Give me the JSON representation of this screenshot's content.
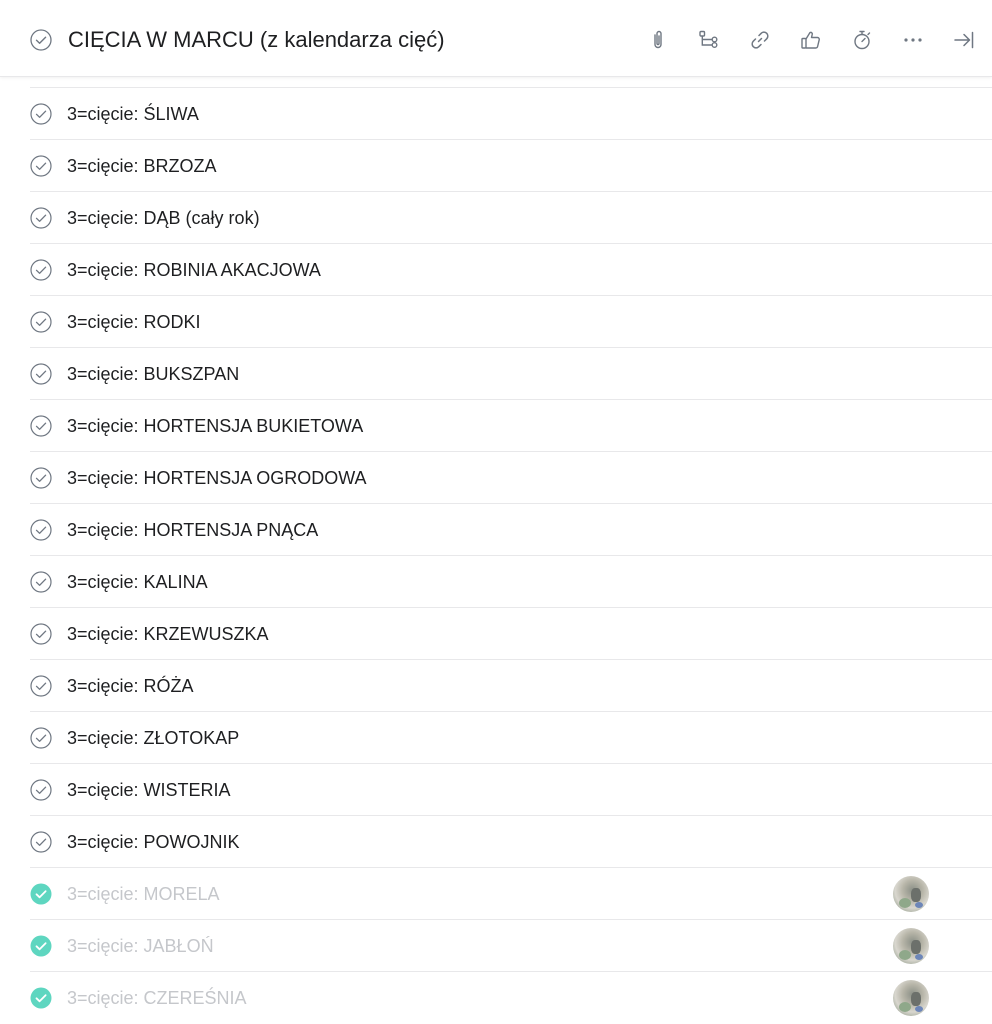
{
  "header": {
    "title": "CIĘCIA W MARCU (z kalendarza cięć)",
    "toolbar": [
      {
        "icon": "paperclip-icon"
      },
      {
        "icon": "subtask-icon"
      },
      {
        "icon": "link-icon"
      },
      {
        "icon": "thumbs-up-icon"
      },
      {
        "icon": "timer-icon"
      },
      {
        "icon": "more-icon"
      },
      {
        "icon": "close-pane-icon"
      }
    ]
  },
  "tasks": [
    {
      "label": "3=cięcie: ŚLIWA",
      "completed": false
    },
    {
      "label": "3=cięcie: BRZOZA",
      "completed": false
    },
    {
      "label": "3=cięcie: DĄB (cały rok)",
      "completed": false
    },
    {
      "label": "3=cięcie: ROBINIA AKACJOWA",
      "completed": false
    },
    {
      "label": "3=cięcie: RODKI",
      "completed": false
    },
    {
      "label": "3=cięcie: BUKSZPAN",
      "completed": false
    },
    {
      "label": "3=cięcie: HORTENSJA BUKIETOWA",
      "completed": false
    },
    {
      "label": "3=cięcie: HORTENSJA OGRODOWA",
      "completed": false
    },
    {
      "label": "3=cięcie: HORTENSJA PNĄCA",
      "completed": false
    },
    {
      "label": "3=cięcie: KALINA",
      "completed": false
    },
    {
      "label": "3=cięcie: KRZEWUSZKA",
      "completed": false
    },
    {
      "label": "3=cięcie: RÓŻA",
      "completed": false
    },
    {
      "label": "3=cięcie: ZŁOTOKAP",
      "completed": false
    },
    {
      "label": "3=cięcie: WISTERIA",
      "completed": false
    },
    {
      "label": "3=cięcie: POWOJNIK",
      "completed": false
    },
    {
      "label": "3=cięcie: MORELA",
      "completed": true,
      "assignee_avatar": true
    },
    {
      "label": "3=cięcie: JABŁOŃ",
      "completed": true,
      "assignee_avatar": true
    },
    {
      "label": "3=cięcie: CZEREŚNIA",
      "completed": true,
      "assignee_avatar": true
    }
  ],
  "colors": {
    "completed_check": "#5ed6c0",
    "completed_text": "#c5c7cb",
    "icon_gray": "#6f7782",
    "divider": "#e8e8ea"
  }
}
